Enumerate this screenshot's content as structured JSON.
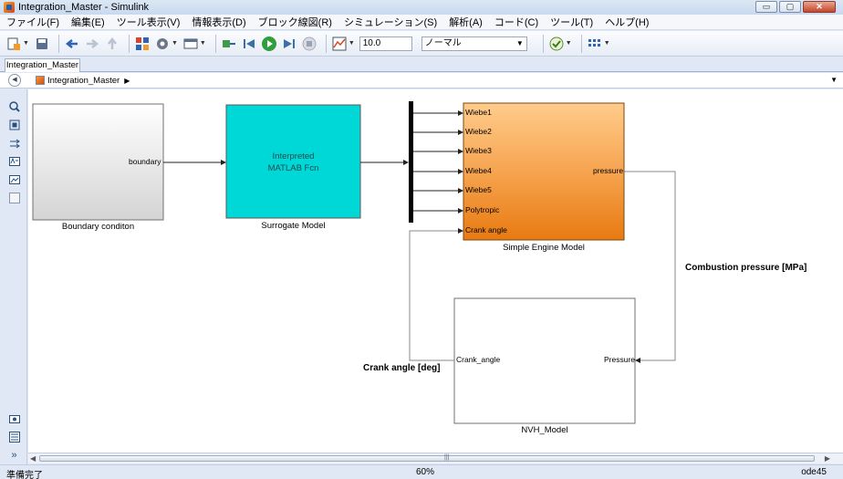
{
  "window": {
    "title": "Integration_Master - Simulink",
    "controls": {
      "minimize": "▭",
      "maximize": "▢",
      "close": "✕"
    }
  },
  "menu": [
    "ファイル(F)",
    "編集(E)",
    "ツール表示(V)",
    "情報表示(D)",
    "ブロック線図(R)",
    "シミュレーション(S)",
    "解析(A)",
    "コード(C)",
    "ツール(T)",
    "ヘルプ(H)"
  ],
  "toolbar": {
    "stop_time": "10.0",
    "sim_mode": "ノーマル",
    "icons": [
      "new-model-icon",
      "save-icon",
      "back-icon",
      "forward-icon",
      "up-icon",
      "library-browser-icon",
      "model-config-icon",
      "explorer-icon",
      "step-back-icon",
      "run-icon",
      "step-forward-icon",
      "stop-icon",
      "scope-icon",
      "check-icon",
      "grid-icon"
    ]
  },
  "tab": {
    "label": "Integration_Master"
  },
  "address": {
    "path": "Integration_Master"
  },
  "blocks": {
    "boundary": {
      "label": "Boundary conditon",
      "port_out": "boundary"
    },
    "surrogate": {
      "label": "Surrogate Model",
      "line1": "Interpreted",
      "line2": "MATLAB Fcn"
    },
    "engine": {
      "label": "Simple Engine Model",
      "inputs": [
        "Wiebe1",
        "Wiebe2",
        "Wiebe3",
        "Wiebe4",
        "Wiebe5",
        "Polytropic",
        "Crank angle"
      ],
      "output": "pressure"
    },
    "nvh": {
      "label": "NVH_Model",
      "port_in_left": "Crank_angle",
      "port_in_right": "Pressure"
    }
  },
  "signals": {
    "combustion": "Combustion pressure [MPa]",
    "crank": "Crank angle [deg]"
  },
  "status": {
    "left": "準備完了",
    "zoom": "60%",
    "solver": "ode45"
  },
  "colors": {
    "surrogate_fill": "#00d7d7",
    "engine_top": "#ffcc8c",
    "engine_bottom": "#e87a10"
  }
}
